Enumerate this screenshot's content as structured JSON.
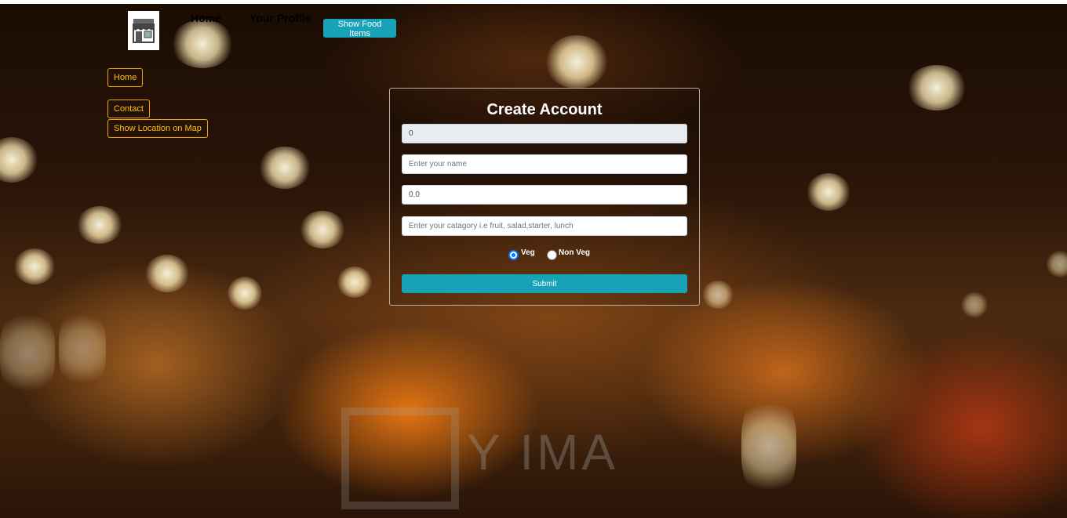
{
  "navbar": {
    "logo_icon": "shop-storefront-icon",
    "links": [
      {
        "label": "Home"
      },
      {
        "label": "Your Profile"
      }
    ],
    "show_food_button": "Show Food Items"
  },
  "sidebar": {
    "home": "Home",
    "contact": "Contact",
    "map": "Show Location on Map"
  },
  "form": {
    "title": "Create Account",
    "id_value": "0",
    "name_placeholder": "Enter your name",
    "price_value": "0.0",
    "category_placeholder": "Enter your catagory i.e fruit, salad,starter, lunch",
    "radio_veg": "Veg",
    "radio_nonveg": "Non Veg",
    "selected": "Veg",
    "submit": "Submit"
  },
  "watermark": "Y IMA",
  "colors": {
    "accent": "#17a2b8",
    "outline": "#ffc107",
    "radio": "#0075ff"
  }
}
